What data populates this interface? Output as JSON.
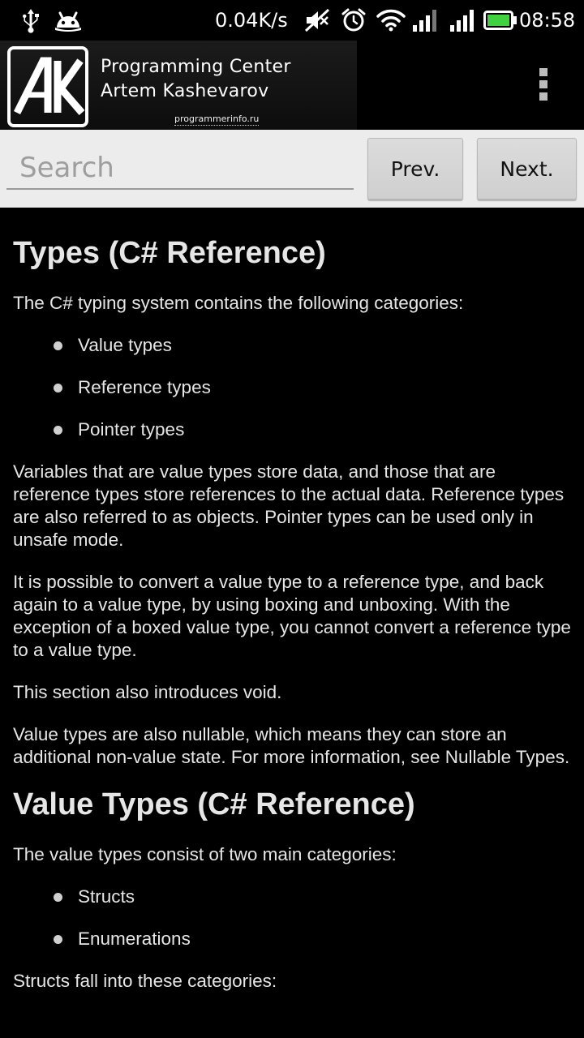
{
  "status_bar": {
    "speed": "0.04K/s",
    "time": "08:58",
    "icons": [
      "usb-icon",
      "android-icon",
      "mute-icon",
      "alarm-icon",
      "wifi-icon",
      "signal-icon",
      "signal-icon-2",
      "battery-icon"
    ],
    "battery_color": "#3fd13f"
  },
  "app_bar": {
    "logo_text": "AK",
    "banner_line1": "Programming Center",
    "banner_line2": "Artem Kashevarov",
    "banner_url": "programmerinfo.ru",
    "menu_icon": "overflow-menu-icon"
  },
  "toolbar": {
    "search_placeholder": "Search",
    "prev_label": "Prev.",
    "next_label": "Next."
  },
  "content": {
    "heading1": "Types (C# Reference)",
    "intro1": "The C# typing system contains the following categories:",
    "list1": [
      "Value types",
      "Reference types",
      "Pointer types"
    ],
    "para1": "Variables that are value types store data, and those that are reference types store references to the actual data. Reference types are also referred to as objects. Pointer types can be used only in unsafe mode.",
    "para2": "It is possible to convert a value type to a reference type, and back again to a value type, by using boxing and unboxing. With the exception of a boxed value type, you cannot convert a reference type to a value type.",
    "para3": "This section also introduces void.",
    "para4": "Value types are also nullable, which means they can store an additional non-value state. For more information, see Nullable Types.",
    "heading2": "Value Types (C# Reference)",
    "intro2": "The value types consist of two main categories:",
    "list2": [
      "Structs",
      "Enumerations"
    ],
    "para5": "Structs fall into these categories:"
  }
}
